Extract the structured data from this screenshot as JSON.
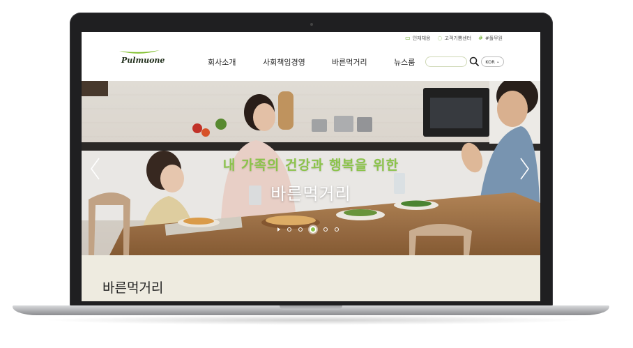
{
  "util_links": [
    {
      "icon": "briefcase-icon",
      "label": "인재채용"
    },
    {
      "icon": "headset-icon",
      "label": "고객기쁨센터"
    },
    {
      "icon": "hashtag-icon",
      "label": "#풀무원"
    }
  ],
  "logo": {
    "text": "Pulmuone"
  },
  "nav": {
    "items": [
      "회사소개",
      "사회책임경영",
      "바른먹거리",
      "뉴스룸"
    ]
  },
  "search": {
    "value": ""
  },
  "language": {
    "selected": "KOR"
  },
  "hero": {
    "headline": "내 가족의 건강과 행복을 위한",
    "subheadline": "바른먹거리",
    "slide_count": 5,
    "active_slide": 3
  },
  "section": {
    "title": "바른먹거리"
  },
  "colors": {
    "accent_green": "#8bc34a",
    "section_bg": "#eeebe0",
    "frame": "#1f1f21"
  }
}
